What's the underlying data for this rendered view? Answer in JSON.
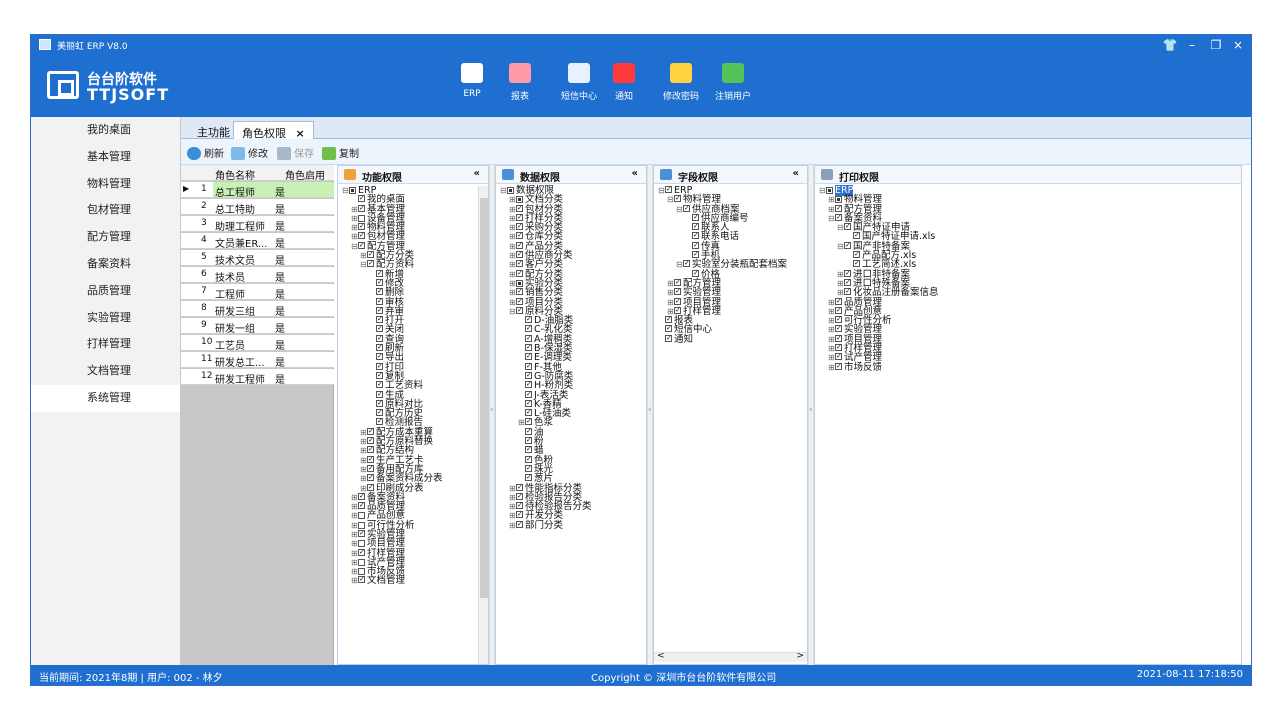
{
  "window": {
    "title": "美丽虹 ERP V8.0"
  },
  "logo": {
    "line1": "台台阶软件",
    "line2": "TTJSOFT"
  },
  "toolbar_top": [
    {
      "label": "ERP",
      "icon": "erp-server-icon",
      "color": "#ffffff"
    },
    {
      "label": "报表",
      "icon": "chart-icon",
      "color": "#ff9aa6"
    },
    {
      "label": "短信中心",
      "icon": "sms-device-icon",
      "color": "#e8f2ff"
    },
    {
      "label": "通知",
      "icon": "notification-icon",
      "color": "#ff3b3b"
    },
    {
      "label": "修改密码",
      "icon": "key-icon",
      "color": "#ffd23f"
    },
    {
      "label": "注销用户",
      "icon": "users-icon",
      "color": "#56c35a"
    }
  ],
  "sidebar": {
    "items": [
      {
        "label": "我的桌面"
      },
      {
        "label": "基本管理"
      },
      {
        "label": "物料管理"
      },
      {
        "label": "包材管理"
      },
      {
        "label": "配方管理"
      },
      {
        "label": "备案资料"
      },
      {
        "label": "品质管理"
      },
      {
        "label": "实验管理"
      },
      {
        "label": "打样管理"
      },
      {
        "label": "文档管理"
      },
      {
        "label": "系统管理"
      }
    ],
    "active_index": 10
  },
  "tabs": [
    {
      "label": "主功能"
    },
    {
      "label": "角色权限",
      "close": "×"
    }
  ],
  "actions": {
    "refresh": "刷新",
    "edit": "修改",
    "save": "保存",
    "copy": "复制"
  },
  "grid": {
    "headers": {
      "name": "角色名称",
      "enabled": "角色启用"
    },
    "rows": [
      {
        "n": "1",
        "name": "总工程师",
        "enabled": "是",
        "current": true
      },
      {
        "n": "2",
        "name": "总工特助",
        "enabled": "是"
      },
      {
        "n": "3",
        "name": "助理工程师",
        "enabled": "是"
      },
      {
        "n": "4",
        "name": "文员兼ER...",
        "enabled": "是"
      },
      {
        "n": "5",
        "name": "技术文员",
        "enabled": "是"
      },
      {
        "n": "6",
        "name": "技术员",
        "enabled": "是"
      },
      {
        "n": "7",
        "name": "工程师",
        "enabled": "是"
      },
      {
        "n": "8",
        "name": "研发三组",
        "enabled": "是"
      },
      {
        "n": "9",
        "name": "研发一组",
        "enabled": "是"
      },
      {
        "n": "10",
        "name": "工艺员",
        "enabled": "是"
      },
      {
        "n": "11",
        "name": "研发总工...",
        "enabled": "是"
      },
      {
        "n": "12",
        "name": "研发工程师",
        "enabled": "是"
      }
    ]
  },
  "panels": {
    "func": {
      "title": "功能权限",
      "nodes": [
        [
          "-",
          0,
          "part",
          "ERP"
        ],
        [
          "",
          1,
          "chk",
          "我的桌面"
        ],
        [
          "+",
          1,
          "chk",
          "基本管理"
        ],
        [
          "+",
          1,
          "",
          "设备管理"
        ],
        [
          "+",
          1,
          "chk",
          "物料管理"
        ],
        [
          "+",
          1,
          "chk",
          "包材管理"
        ],
        [
          "-",
          1,
          "chk",
          "配方管理"
        ],
        [
          "+",
          2,
          "chk",
          "配方分类"
        ],
        [
          "-",
          2,
          "chk",
          "配方资料"
        ],
        [
          "",
          3,
          "chk",
          "新增"
        ],
        [
          "",
          3,
          "chk",
          "修改"
        ],
        [
          "",
          3,
          "chk",
          "删除"
        ],
        [
          "",
          3,
          "chk",
          "审核"
        ],
        [
          "",
          3,
          "chk",
          "弃审"
        ],
        [
          "",
          3,
          "chk",
          "打开"
        ],
        [
          "",
          3,
          "chk",
          "关闭"
        ],
        [
          "",
          3,
          "chk",
          "查询"
        ],
        [
          "",
          3,
          "chk",
          "刷新"
        ],
        [
          "",
          3,
          "chk",
          "导出"
        ],
        [
          "",
          3,
          "chk",
          "打印"
        ],
        [
          "",
          3,
          "chk",
          "复制"
        ],
        [
          "",
          3,
          "chk",
          "工艺资料"
        ],
        [
          "",
          3,
          "chk",
          "生成"
        ],
        [
          "",
          3,
          "chk",
          "原料对比"
        ],
        [
          "",
          3,
          "chk",
          "配方历史"
        ],
        [
          "",
          3,
          "chk",
          "检测报告"
        ],
        [
          "+",
          2,
          "chk",
          "配方成本重算"
        ],
        [
          "+",
          2,
          "chk",
          "配方原料替换"
        ],
        [
          "+",
          2,
          "chk",
          "配方结构"
        ],
        [
          "+",
          2,
          "chk",
          "生产工艺卡"
        ],
        [
          "+",
          2,
          "chk",
          "备用配方库"
        ],
        [
          "+",
          2,
          "chk",
          "备案资料成分表"
        ],
        [
          "+",
          2,
          "chk",
          "印刷成分表"
        ],
        [
          "+",
          1,
          "chk",
          "备案资料"
        ],
        [
          "+",
          1,
          "chk",
          "品质管理"
        ],
        [
          "+",
          1,
          "",
          "产品创意"
        ],
        [
          "+",
          1,
          "",
          "可行性分析"
        ],
        [
          "+",
          1,
          "chk",
          "实验管理"
        ],
        [
          "+",
          1,
          "",
          "项目管理"
        ],
        [
          "+",
          1,
          "chk",
          "打样管理"
        ],
        [
          "+",
          1,
          "",
          "试产管理"
        ],
        [
          "+",
          1,
          "",
          "市场反馈"
        ],
        [
          "+",
          1,
          "chk",
          "文档管理"
        ]
      ]
    },
    "data": {
      "title": "数据权限",
      "nodes": [
        [
          "-",
          0,
          "part",
          "数据权限"
        ],
        [
          "+",
          1,
          "part",
          "文档分类"
        ],
        [
          "+",
          1,
          "chk",
          "包材分类"
        ],
        [
          "+",
          1,
          "chk",
          "打样分类"
        ],
        [
          "+",
          1,
          "chk",
          "采购分类"
        ],
        [
          "+",
          1,
          "chk",
          "仓库分类"
        ],
        [
          "+",
          1,
          "chk",
          "产品分类"
        ],
        [
          "+",
          1,
          "chk",
          "供应商分类"
        ],
        [
          "+",
          1,
          "chk",
          "客户分类"
        ],
        [
          "+",
          1,
          "chk",
          "配方分类"
        ],
        [
          "+",
          1,
          "part",
          "实验分类"
        ],
        [
          "+",
          1,
          "chk",
          "销售分类"
        ],
        [
          "+",
          1,
          "chk",
          "项目分类"
        ],
        [
          "-",
          1,
          "chk",
          "原料分类"
        ],
        [
          "",
          2,
          "chk",
          "D-油脂类"
        ],
        [
          "",
          2,
          "chk",
          "C-乳化类"
        ],
        [
          "",
          2,
          "chk",
          "A-增稠类"
        ],
        [
          "",
          2,
          "chk",
          "B-保湿类"
        ],
        [
          "",
          2,
          "chk",
          "E-调理类"
        ],
        [
          "",
          2,
          "chk",
          "F-其他"
        ],
        [
          "",
          2,
          "chk",
          "G-防腐类"
        ],
        [
          "",
          2,
          "chk",
          "H-粉剂类"
        ],
        [
          "",
          2,
          "chk",
          "J-表活类"
        ],
        [
          "",
          2,
          "chk",
          "K-香精"
        ],
        [
          "",
          2,
          "chk",
          "L-硅油类"
        ],
        [
          "+",
          2,
          "chk",
          "色浆"
        ],
        [
          "",
          2,
          "chk",
          "油"
        ],
        [
          "",
          2,
          "chk",
          "粉"
        ],
        [
          "",
          2,
          "chk",
          "蜡"
        ],
        [
          "",
          2,
          "chk",
          "色粉"
        ],
        [
          "",
          2,
          "chk",
          "珠光"
        ],
        [
          "",
          2,
          "chk",
          "葱片"
        ],
        [
          "+",
          1,
          "chk",
          "性能指标分类"
        ],
        [
          "+",
          1,
          "chk",
          "检验报告分类"
        ],
        [
          "+",
          1,
          "chk",
          "待检验报告分类"
        ],
        [
          "+",
          1,
          "chk",
          "开发分类"
        ],
        [
          "+",
          1,
          "chk",
          "部门分类"
        ]
      ]
    },
    "field": {
      "title": "字段权限",
      "nodes": [
        [
          "-",
          0,
          "chk",
          "ERP"
        ],
        [
          "-",
          1,
          "chk",
          "物料管理"
        ],
        [
          "-",
          2,
          "chk",
          "供应商档案"
        ],
        [
          "",
          3,
          "chk",
          "供应商编号"
        ],
        [
          "",
          3,
          "chk",
          "联系人"
        ],
        [
          "",
          3,
          "chk",
          "联系电话"
        ],
        [
          "",
          3,
          "chk",
          "传真"
        ],
        [
          "",
          3,
          "chk",
          "手机"
        ],
        [
          "-",
          2,
          "chk",
          "实验室分装瓶配套档案"
        ],
        [
          "",
          3,
          "chk",
          "价格"
        ],
        [
          "+",
          1,
          "chk",
          "配方管理"
        ],
        [
          "+",
          1,
          "chk",
          "实验管理"
        ],
        [
          "+",
          1,
          "chk",
          "项目管理"
        ],
        [
          "+",
          1,
          "chk",
          "打样管理"
        ],
        [
          "",
          0,
          "chk",
          "报表"
        ],
        [
          "",
          0,
          "chk",
          "短信中心"
        ],
        [
          "",
          0,
          "chk",
          "通知"
        ]
      ]
    },
    "print": {
      "title": "打印权限",
      "nodes": [
        [
          "-",
          0,
          "part",
          "ERP"
        ],
        [
          "+",
          1,
          "part",
          "物料管理"
        ],
        [
          "+",
          1,
          "chk",
          "配方管理"
        ],
        [
          "-",
          1,
          "chk",
          "备案资料"
        ],
        [
          "-",
          2,
          "chk",
          "国产特证申请"
        ],
        [
          "",
          3,
          "chk",
          "国产特证申请.xls"
        ],
        [
          "-",
          2,
          "chk",
          "国产非特备案"
        ],
        [
          "",
          3,
          "chk",
          "产品配方.xls"
        ],
        [
          "",
          3,
          "chk",
          "工艺简述.xls"
        ],
        [
          "+",
          2,
          "chk",
          "进口非特备案"
        ],
        [
          "+",
          2,
          "chk",
          "进口特殊备案"
        ],
        [
          "+",
          2,
          "chk",
          "化妆品注册备案信息"
        ],
        [
          "+",
          1,
          "chk",
          "品质管理"
        ],
        [
          "+",
          1,
          "chk",
          "产品创意"
        ],
        [
          "+",
          1,
          "chk",
          "可行性分析"
        ],
        [
          "+",
          1,
          "chk",
          "实验管理"
        ],
        [
          "+",
          1,
          "chk",
          "项目管理"
        ],
        [
          "+",
          1,
          "chk",
          "打样管理"
        ],
        [
          "+",
          1,
          "chk",
          "试产管理"
        ],
        [
          "+",
          1,
          "chk",
          "市场反馈"
        ]
      ]
    }
  },
  "status": {
    "period": "当前期间:  2021年8期  |  用户:  002 - 林夕",
    "copyright": "Copyright © 深圳市台台阶软件有限公司",
    "datetime": "2021-08-11 17:18:50"
  }
}
